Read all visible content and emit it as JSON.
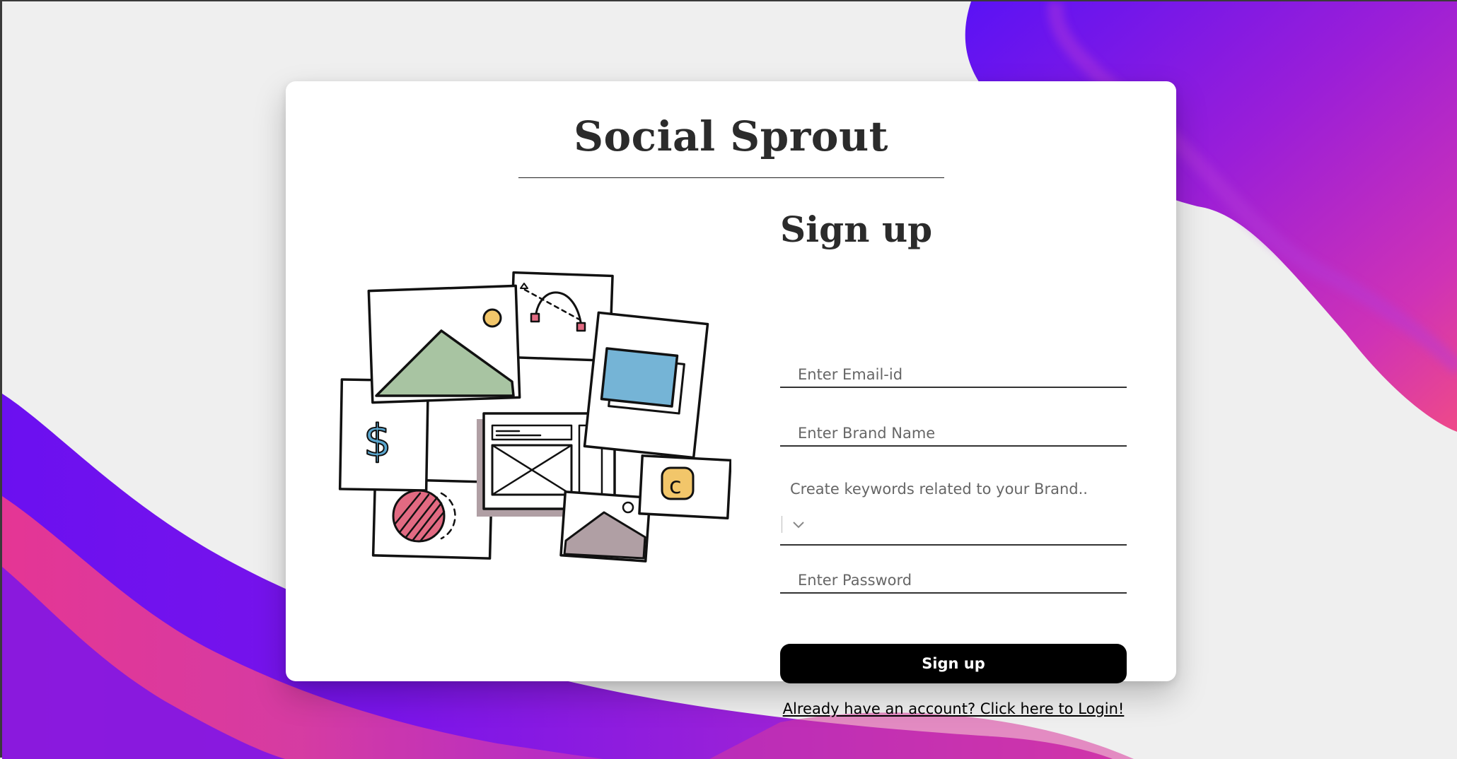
{
  "app": {
    "title": "Social Sprout"
  },
  "signup": {
    "heading": "Sign up",
    "email_placeholder": "Enter Email-id",
    "brand_placeholder": "Enter Brand Name",
    "keywords_label": "Create keywords related to your Brand..",
    "password_placeholder": "Enter Password",
    "submit_label": "Sign up",
    "login_link": "Already have an account? Click here to Login!"
  },
  "icons": {
    "keywords_dropdown": "chevron-down-icon"
  },
  "colors": {
    "gradient_purple": "#6a12f2",
    "gradient_magenta": "#c52fc4",
    "gradient_pink": "#f0407e",
    "button": "#000000",
    "card": "#ffffff",
    "background": "#efefef"
  }
}
